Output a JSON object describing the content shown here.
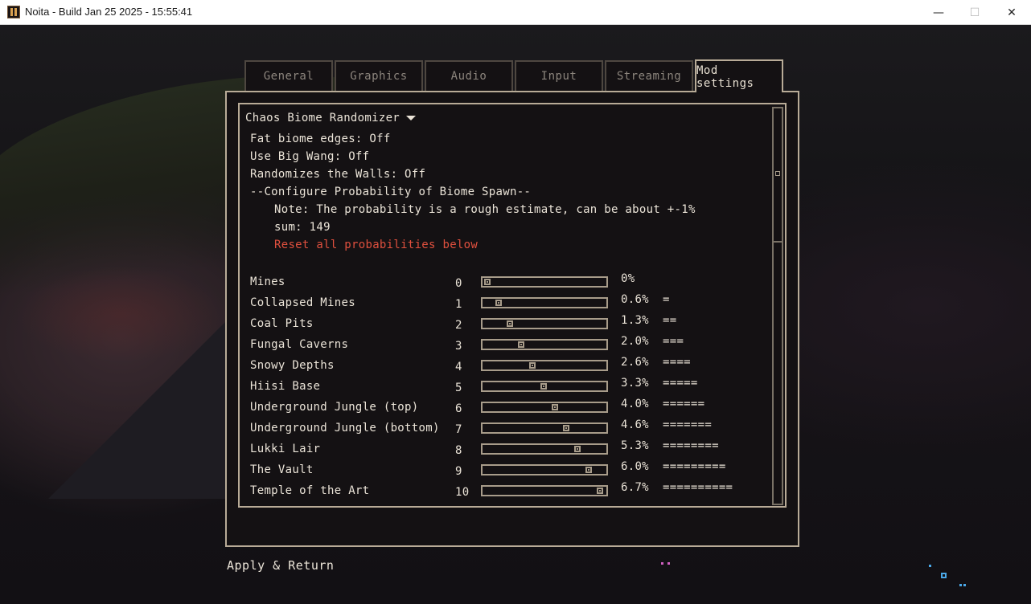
{
  "window": {
    "title": "Noita - Build Jan 25 2025 - 15:55:41",
    "minimize": "—",
    "maximize": "☐",
    "close": "✕"
  },
  "tabs": [
    "General",
    "Graphics",
    "Audio",
    "Input",
    "Streaming",
    "Mod settings"
  ],
  "active_tab": "Mod settings",
  "mod": {
    "name": "Chaos Biome Randomizer",
    "settings": [
      "Fat biome edges: Off",
      "Use Big Wang: Off",
      "Randomizes the Walls: Off",
      "--Configure Probability of Biome Spawn--"
    ],
    "note": "Note: The probability is a rough estimate, can be about +-1%",
    "sum": "sum: 149",
    "reset": "Reset all probabilities below"
  },
  "biomes": [
    {
      "name": "Mines",
      "value": "0",
      "percent": "0%",
      "bars": "",
      "slider": 0.0
    },
    {
      "name": "Collapsed Mines",
      "value": "1",
      "percent": "0.6%",
      "bars": "=",
      "slider": 0.1
    },
    {
      "name": "Coal Pits",
      "value": "2",
      "percent": "1.3%",
      "bars": "==",
      "slider": 0.2
    },
    {
      "name": "Fungal Caverns",
      "value": "3",
      "percent": "2.0%",
      "bars": "===",
      "slider": 0.3
    },
    {
      "name": "Snowy Depths",
      "value": "4",
      "percent": "2.6%",
      "bars": "====",
      "slider": 0.4
    },
    {
      "name": "Hiisi Base",
      "value": "5",
      "percent": "3.3%",
      "bars": "=====",
      "slider": 0.5
    },
    {
      "name": "Underground Jungle (top)",
      "value": "6",
      "percent": "4.0%",
      "bars": "======",
      "slider": 0.6
    },
    {
      "name": "Underground Jungle (bottom)",
      "value": "7",
      "percent": "4.6%",
      "bars": "=======",
      "slider": 0.7
    },
    {
      "name": "Lukki Lair",
      "value": "8",
      "percent": "5.3%",
      "bars": "========",
      "slider": 0.8
    },
    {
      "name": "The Vault",
      "value": "9",
      "percent": "6.0%",
      "bars": "=========",
      "slider": 0.9
    },
    {
      "name": "Temple of the Art",
      "value": "10",
      "percent": "6.7%",
      "bars": "==========",
      "slider": 1.0
    }
  ],
  "footer": {
    "apply": "Apply & Return"
  }
}
